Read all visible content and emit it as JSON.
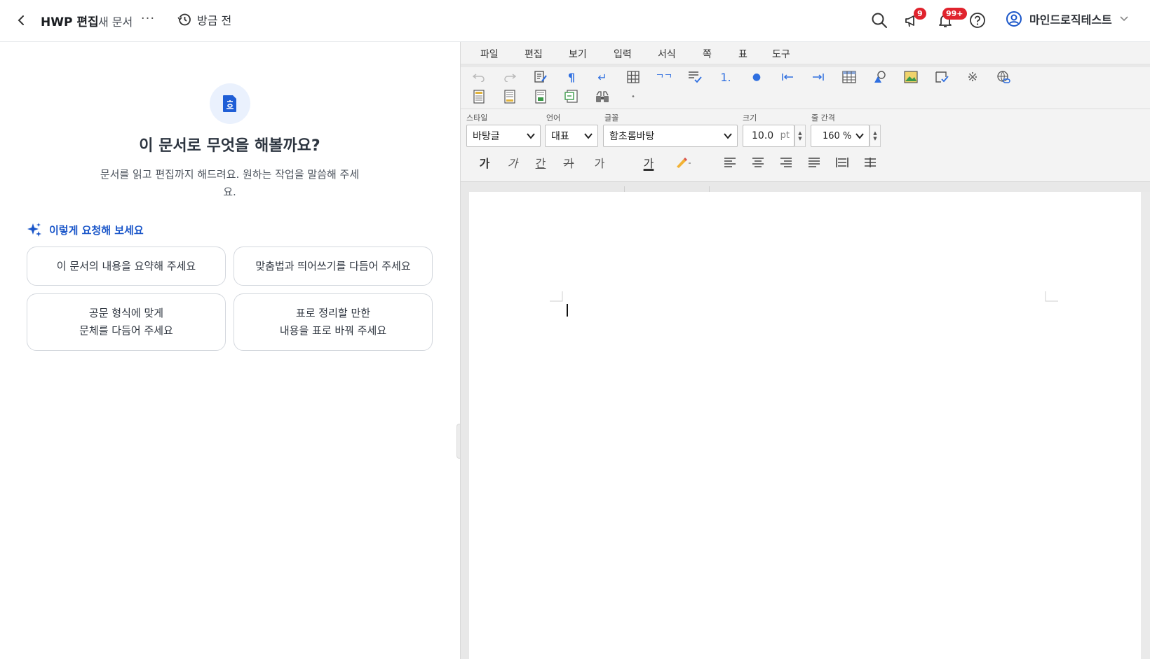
{
  "header": {
    "title": "HWP 편집",
    "doc_name": "새 문서",
    "more": "···",
    "history_label": "방금 전",
    "announce_badge": "9",
    "notif_badge": "99+",
    "user_name": "마인드로직테스트"
  },
  "assistant": {
    "heading": "이 문서로 무엇을 해볼까요?",
    "description": "문서를 읽고 편집까지 해드려요. 원하는 작업을 말씀해 주세요.",
    "suggest_label": "이렇게 요청해 보세요",
    "chips": [
      "이 문서의 내용을 요약해 주세요",
      "맞춤법과 띄어쓰기를 다듬어 주세요",
      "공문 형식에 맞게\n문체를 다듬어 주세요",
      "표로 정리할 만한\n내용을 표로 바꿔 주세요"
    ]
  },
  "editor": {
    "menu": [
      "파일",
      "편집",
      "보기",
      "입력",
      "서식",
      "쪽",
      "표",
      "도구"
    ],
    "labels": {
      "style": "스타일",
      "language": "언어",
      "font": "글꼴",
      "size": "크기",
      "line_spacing": "줄 간격"
    },
    "values": {
      "style": "바탕글",
      "language": "대표",
      "font": "함초롬바탕",
      "size": "10.0",
      "size_unit": "pt",
      "line_spacing": "160 %"
    },
    "char_buttons": [
      "가",
      "가",
      "간",
      "가",
      "가"
    ],
    "color_button": "가"
  },
  "colors": {
    "accent": "#1a56c9",
    "badge": "#e0232d",
    "icon_blue": "#2f6fe0"
  }
}
